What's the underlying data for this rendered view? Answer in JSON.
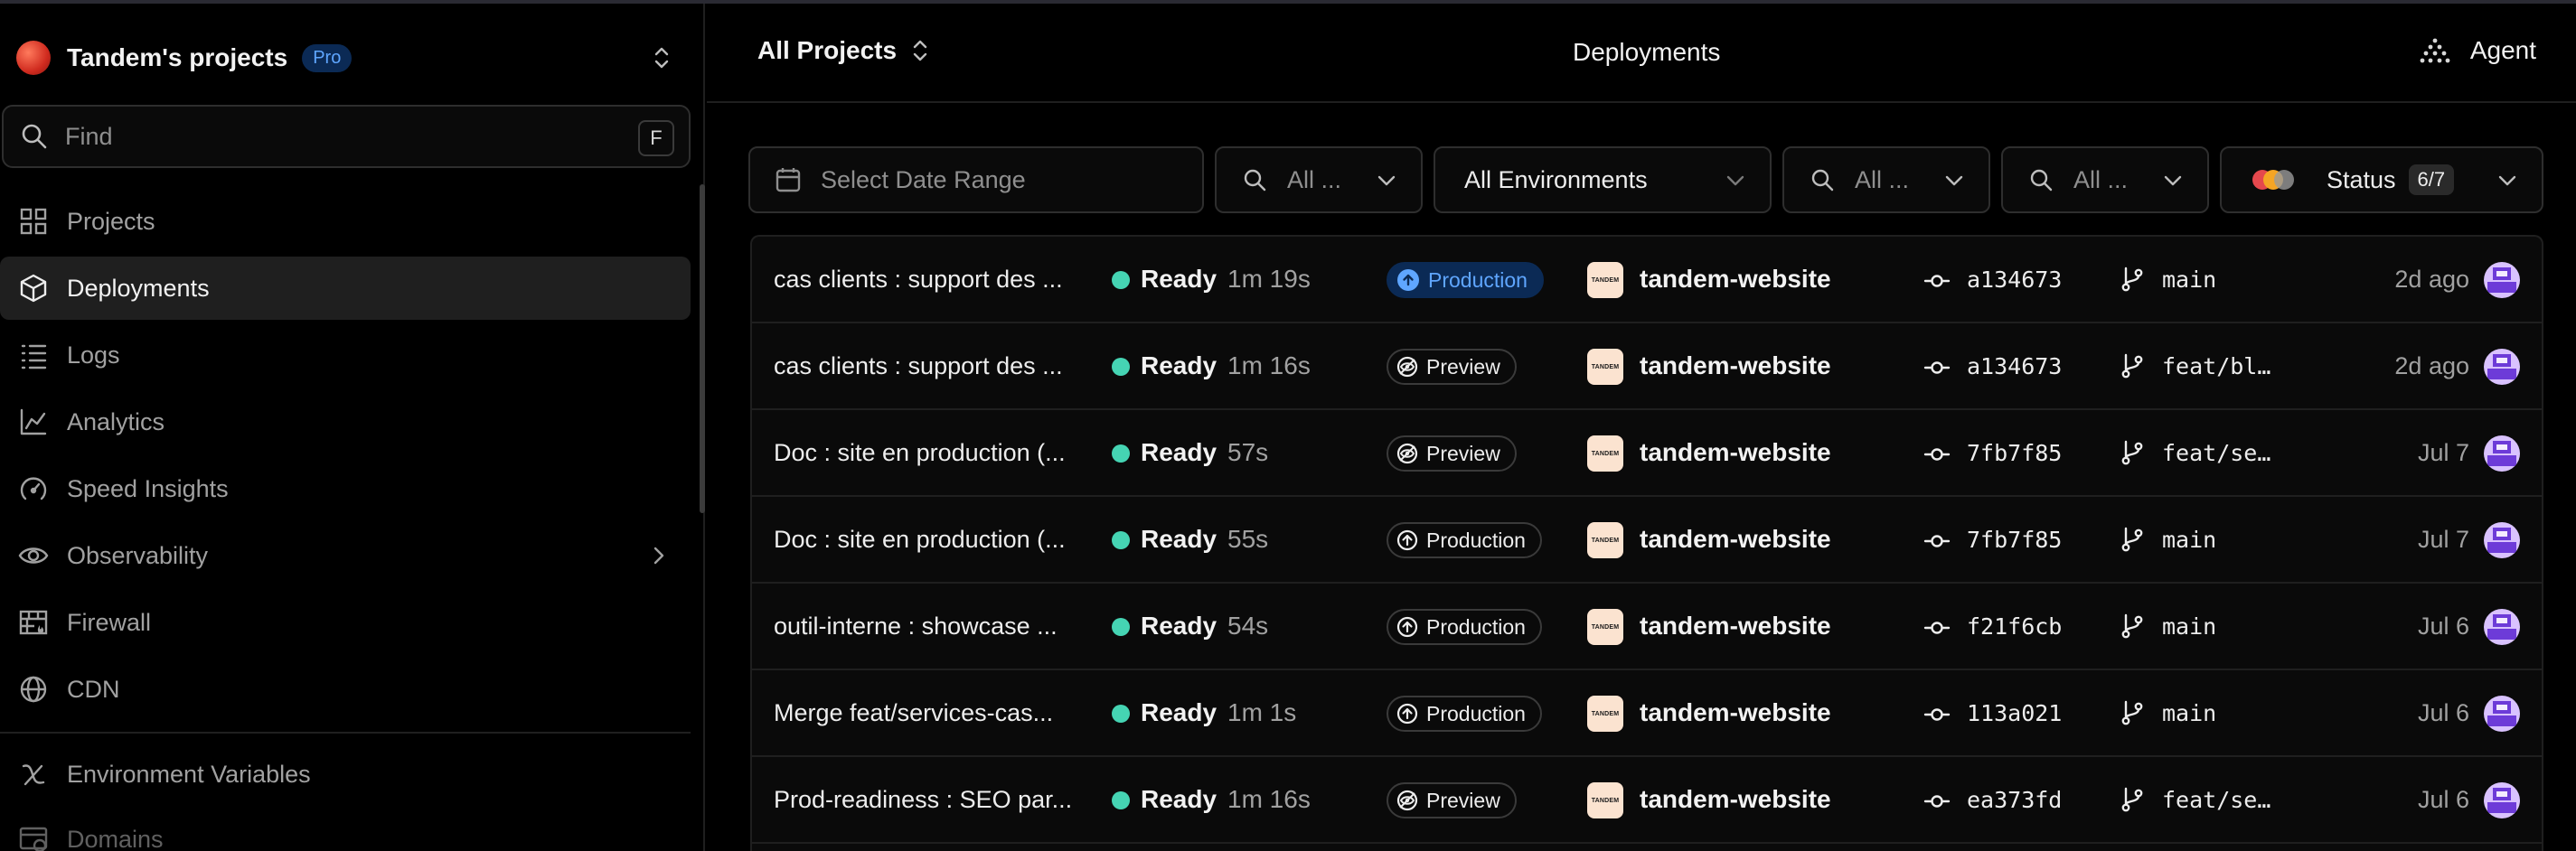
{
  "team": {
    "name": "Tandem's projects",
    "plan_badge": "Pro"
  },
  "search": {
    "placeholder": "Find",
    "shortcut": "F"
  },
  "sidebar": {
    "items": [
      {
        "label": "Projects",
        "icon": "grid-icon"
      },
      {
        "label": "Deployments",
        "icon": "cube-icon",
        "active": true
      },
      {
        "label": "Logs",
        "icon": "list-icon"
      },
      {
        "label": "Analytics",
        "icon": "chart-line-icon"
      },
      {
        "label": "Speed Insights",
        "icon": "gauge-icon"
      },
      {
        "label": "Observability",
        "icon": "eye-icon",
        "has_submenu": true
      },
      {
        "label": "Firewall",
        "icon": "firewall-icon"
      },
      {
        "label": "CDN",
        "icon": "globe-icon"
      },
      {
        "label": "Environment Variables",
        "icon": "variable-icon"
      },
      {
        "label": "Domains",
        "icon": "domains-icon"
      }
    ]
  },
  "header": {
    "project_selector": "All Projects",
    "title": "Deployments",
    "agent_label": "Agent"
  },
  "filters": {
    "date_range_placeholder": "Select Date Range",
    "search_1": "All ...",
    "environment": "All Environments",
    "search_2": "All ...",
    "search_3": "All ...",
    "status_label": "Status",
    "status_count": "6/7",
    "status_colors": [
      "#e5484d",
      "#f5a524",
      "#9a9a9a"
    ]
  },
  "deployments": [
    {
      "title": "cas clients : support des ...",
      "status": "Ready",
      "duration": "1m 19s",
      "environment": "Production",
      "env_current": true,
      "project": "tandem-website",
      "commit": "a134673",
      "branch": "main",
      "age": "2d ago"
    },
    {
      "title": "cas clients : support des ...",
      "status": "Ready",
      "duration": "1m 16s",
      "environment": "Preview",
      "env_current": false,
      "project": "tandem-website",
      "commit": "a134673",
      "branch": "feat/bl…",
      "age": "2d ago"
    },
    {
      "title": "Doc : site en production (...",
      "status": "Ready",
      "duration": "57s",
      "environment": "Preview",
      "env_current": false,
      "project": "tandem-website",
      "commit": "7fb7f85",
      "branch": "feat/se…",
      "age": "Jul 7"
    },
    {
      "title": "Doc : site en production (...",
      "status": "Ready",
      "duration": "55s",
      "environment": "Production",
      "env_current": false,
      "project": "tandem-website",
      "commit": "7fb7f85",
      "branch": "main",
      "age": "Jul 7"
    },
    {
      "title": "outil-interne : showcase ...",
      "status": "Ready",
      "duration": "54s",
      "environment": "Production",
      "env_current": false,
      "project": "tandem-website",
      "commit": "f21f6cb",
      "branch": "main",
      "age": "Jul 6"
    },
    {
      "title": "Merge feat/services-cas...",
      "status": "Ready",
      "duration": "1m 1s",
      "environment": "Production",
      "env_current": false,
      "project": "tandem-website",
      "commit": "113a021",
      "branch": "main",
      "age": "Jul 6"
    },
    {
      "title": "Prod-readiness : SEO par...",
      "status": "Ready",
      "duration": "1m 16s",
      "environment": "Preview",
      "env_current": false,
      "project": "tandem-website",
      "commit": "ea373fd",
      "branch": "feat/se…",
      "age": "Jul 6"
    }
  ],
  "project_logo_text": "TANDEM",
  "colors": {
    "ready": "#45d4b3",
    "accent_blue": "#5fa6ff",
    "badge_blue_bg": "#0b2a55"
  }
}
